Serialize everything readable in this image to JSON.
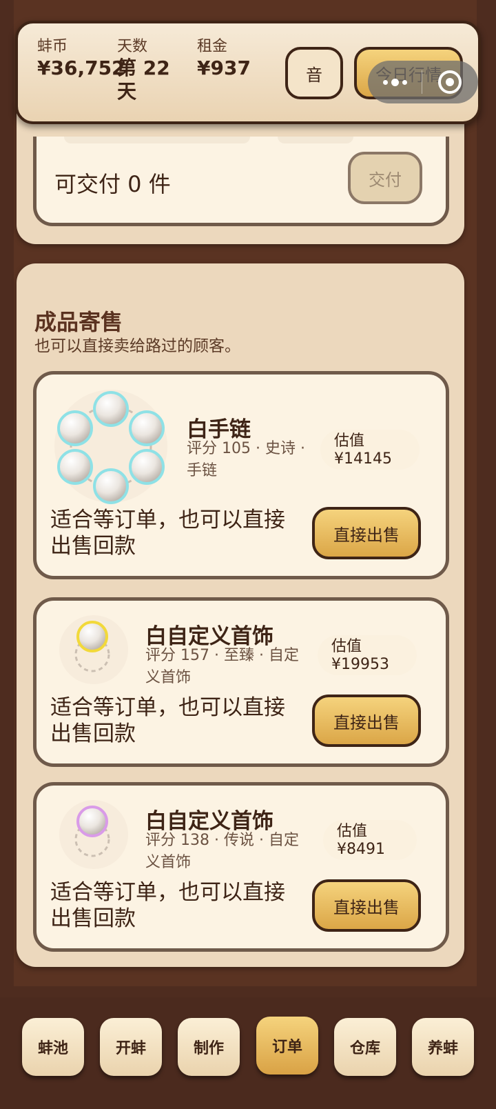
{
  "header": {
    "stats": [
      {
        "label": "蚌币",
        "value": "¥36,752"
      },
      {
        "label": "天数",
        "value": "第 22 天"
      },
      {
        "label": "租金",
        "value": "¥937"
      }
    ],
    "sound_label": "音",
    "market_label": "今日行情"
  },
  "delivery": {
    "text": "可交付 0 件",
    "button_label": "交付"
  },
  "sale": {
    "title": "成品寄售",
    "subtitle": "也可以直接卖给路过的顾客。",
    "items": [
      {
        "name": "白手链",
        "meta": "评分 105 · 史诗 · 手链",
        "value_label": "估值",
        "value": "¥14145",
        "desc": "适合等订单，也可以直接出售回款",
        "sell_label": "直接出售",
        "bead_ring_color": "#8ee1e6"
      },
      {
        "name": "白自定义首饰",
        "meta": "评分 157 · 至臻 · 自定义首饰",
        "value_label": "估值",
        "value": "¥19953",
        "desc": "适合等订单，也可以直接出售回款",
        "sell_label": "直接出售",
        "bead_ring_color": "#f2d93a"
      },
      {
        "name": "白自定义首饰",
        "meta": "评分 138 · 传说 · 自定义首饰",
        "value_label": "估值",
        "value": "¥8491",
        "desc": "适合等订单，也可以直接出售回款",
        "sell_label": "直接出售",
        "bead_ring_color": "#d99be8"
      }
    ]
  },
  "tabs": [
    "蚌池",
    "开蚌",
    "制作",
    "订单",
    "仓库",
    "养蚌"
  ],
  "active_tab": "订单",
  "colors": {
    "accent_gold": "#dba647",
    "border_brown": "#3e2416",
    "panel_beige": "#ecd8bd",
    "background": "#4e2c1f"
  }
}
